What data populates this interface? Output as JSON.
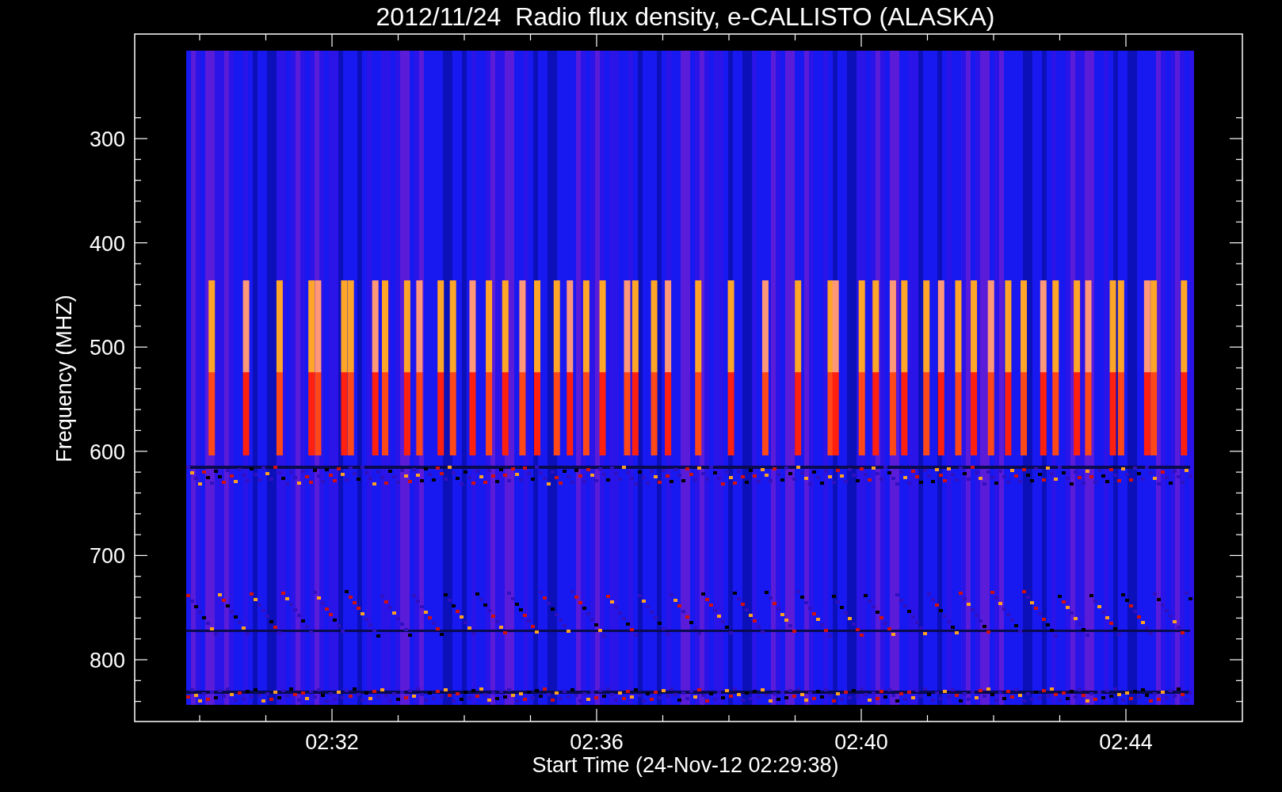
{
  "title": "2012/11/24  Radio flux density, e-CALLISTO (ALASKA)",
  "y_axis": {
    "label": "Frequency (MHZ)",
    "ticks": [
      "300",
      "400",
      "500",
      "600",
      "700",
      "800"
    ]
  },
  "x_axis": {
    "label": "Start Time (24-Nov-12 02:29:38)",
    "ticks": [
      "02:32",
      "02:36",
      "02:40",
      "02:44"
    ]
  }
}
